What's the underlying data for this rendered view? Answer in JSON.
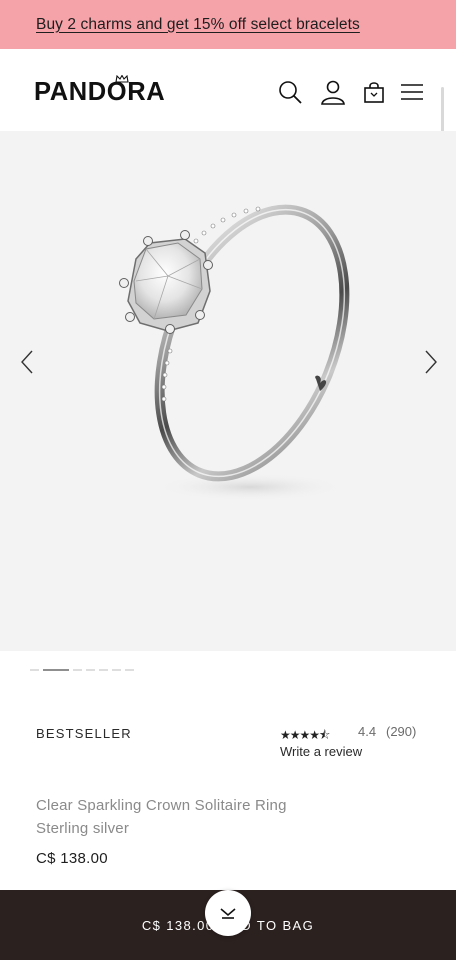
{
  "promo": {
    "text": "Buy 2 charms and get 15% off select bracelets"
  },
  "header": {
    "logo_text": "PANDORA",
    "icons": [
      "search-icon",
      "account-icon",
      "bag-icon",
      "menu-icon"
    ]
  },
  "gallery": {
    "image": "ring-photo",
    "slide_count": 8,
    "active_slide": 2
  },
  "product": {
    "badge": "BESTSELLER",
    "rating": {
      "stars_glyph": "★★★★⯪",
      "value": "4.4",
      "count": "(290)",
      "stars": 4.4
    },
    "review_link": "Write a review",
    "name": "Clear Sparkling Crown Solitaire Ring",
    "material": "Sterling silver",
    "price": "C$ 138.00"
  },
  "bottom_bar": {
    "price": "C$ 138.00",
    "label": "ADD TO BAG"
  },
  "colors": {
    "promo_bg": "#f6a2a9",
    "bottom_bar_bg": "#2b211f",
    "gallery_bg": "#f3f3f3"
  }
}
